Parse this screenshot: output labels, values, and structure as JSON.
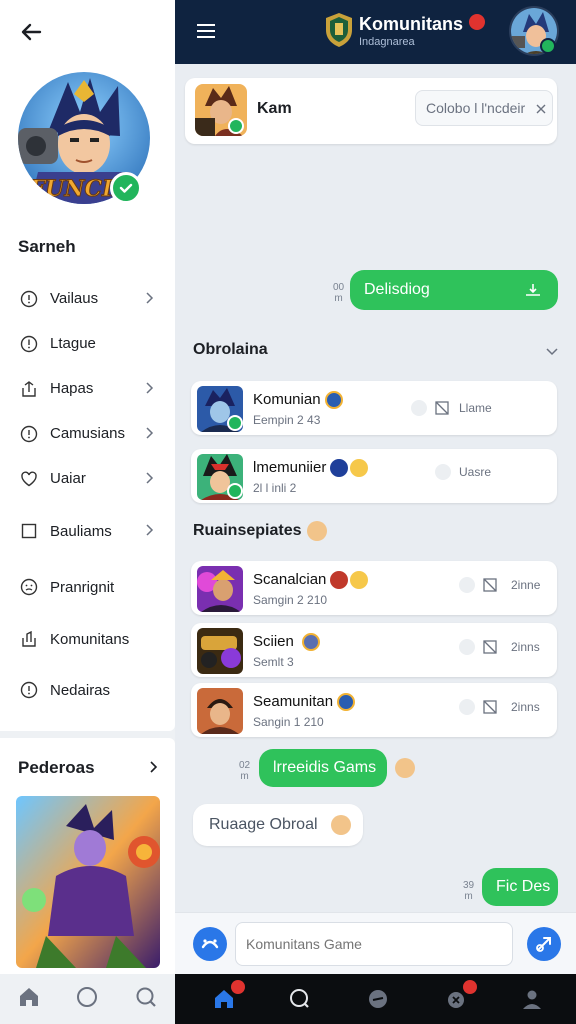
{
  "sidebar": {
    "profile_name": "Sarneh",
    "avatar_text": "FUNCIIS",
    "menu": [
      {
        "label": "Vailaus",
        "chevron": true
      },
      {
        "label": "Ltague",
        "chevron": false
      },
      {
        "label": "Hapas",
        "chevron": true
      },
      {
        "label": "Camusians",
        "chevron": true
      },
      {
        "label": "Uaiar",
        "chevron": true
      },
      {
        "label": "Bauliams",
        "chevron": true
      },
      {
        "label": "Pranrignit",
        "chevron": false
      },
      {
        "label": "Komunitans",
        "chevron": false
      },
      {
        "label": "Nedairas",
        "chevron": false
      }
    ],
    "featured_title": "Pederoas"
  },
  "header": {
    "title": "Komunitans",
    "subtitle": "Indagnarea"
  },
  "top_card": {
    "name": "Kam",
    "search_value": "Colobo l l'ncdeir"
  },
  "messages": {
    "out_1": {
      "text": "Delisdiog",
      "time_1": "00",
      "time_2": "m"
    },
    "out_2": {
      "text": "lrreeidis Gams",
      "time_1": "02",
      "time_2": "m"
    },
    "in_1": {
      "text": "Ruaage Obroal"
    },
    "out_3": {
      "text": "Fic Des",
      "time_1": "39",
      "time_2": "m"
    }
  },
  "section_1": {
    "title": "Obrolaina",
    "items": [
      {
        "title": "Komunian",
        "sub": "Eempin 2 43",
        "meta": "Llame"
      },
      {
        "title": "lmemuniier",
        "sub": "2l l inli 2",
        "meta": "Uasre"
      }
    ]
  },
  "section_2": {
    "title": "Ruainsepiates",
    "items": [
      {
        "title": "Scanalcian",
        "sub": "Samgin 2 210",
        "meta": "2inne"
      },
      {
        "title": "Sciien",
        "sub": "Semlt 3",
        "meta": "2inns"
      },
      {
        "title": "Seamunitan",
        "sub": "Sangin 1 210",
        "meta": "2inns"
      }
    ]
  },
  "composer": {
    "placeholder": "Komunitans Game"
  },
  "colors": {
    "header_bg": "#0f2340",
    "accent_green": "#2fc25b",
    "accent_blue": "#2a77e8",
    "badge_red": "#e0332f"
  }
}
